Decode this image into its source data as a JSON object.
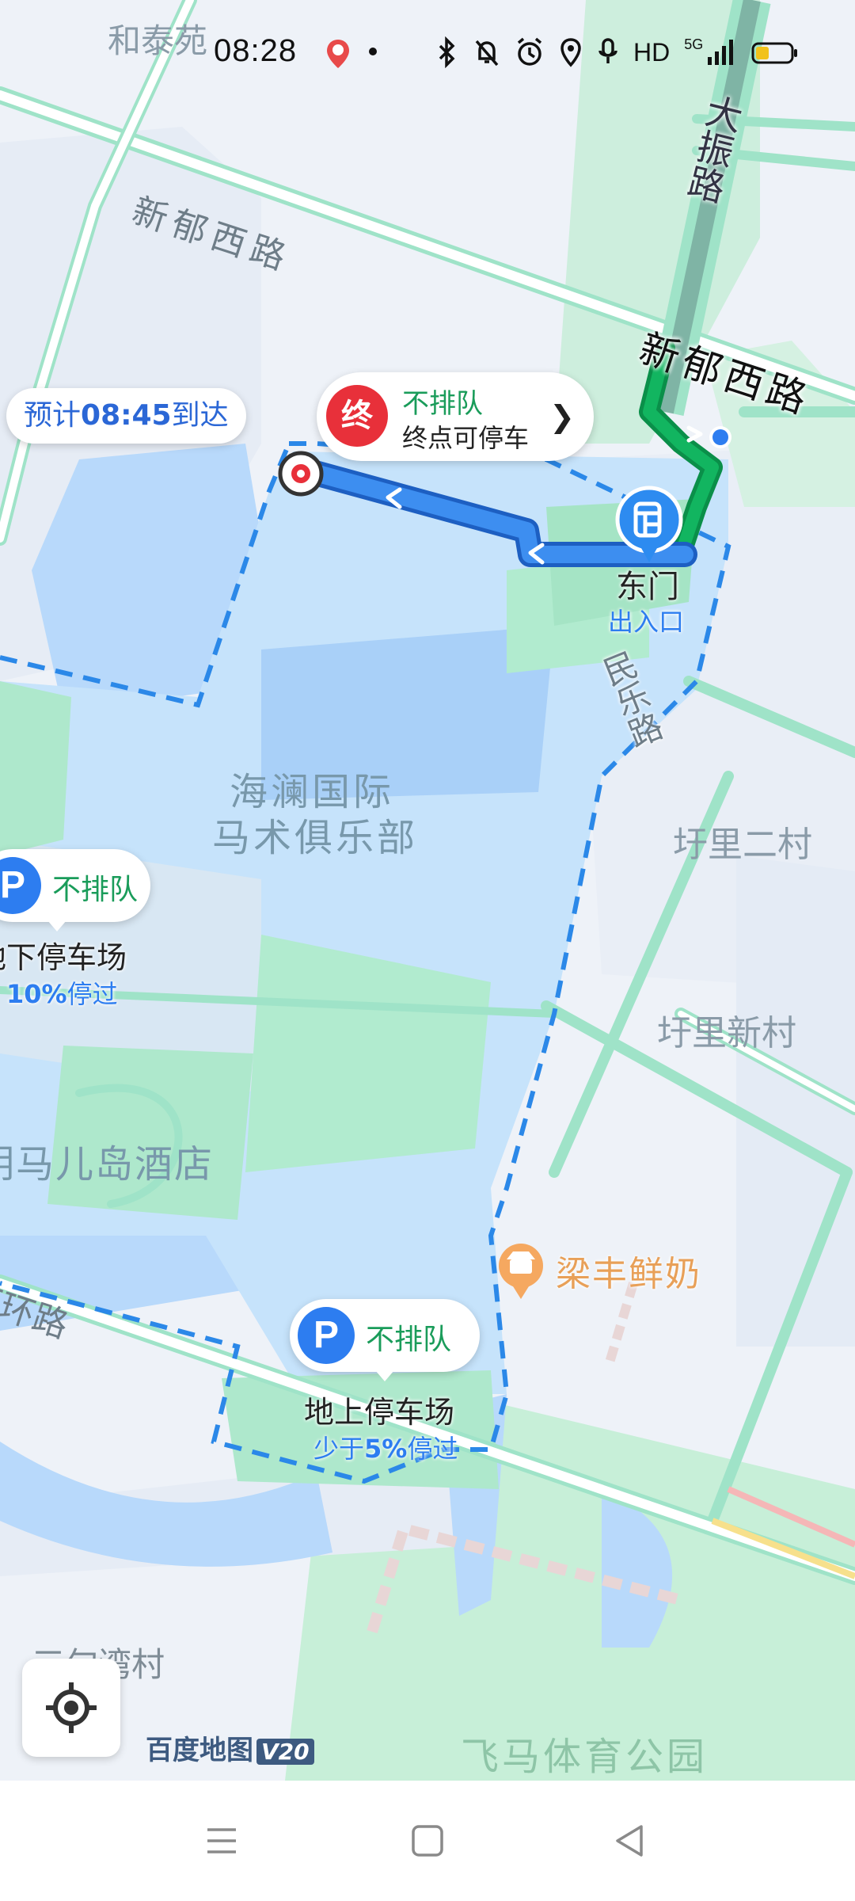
{
  "status_bar": {
    "time": "08:28",
    "hd": "HD",
    "network": "5G"
  },
  "map": {
    "labels": {
      "hetaiyuan": "和泰苑",
      "xinyu_west_road_top": "新郁西路",
      "xinyu_west_road_main": "新郁西路",
      "dazhen_road": "大振路",
      "minle_road": "民乐路",
      "club": "海澜国际\n马术俱乐部",
      "club_line1": "海澜国际",
      "club_line2": "马术俱乐部",
      "yuli_ercun": "圩里二村",
      "yuli_xincun": "圩里新村",
      "hotel": "明马儿岛酒店",
      "ring_road": "西环路",
      "liangfeng_milk": "梁丰鲜奶",
      "feima_park": "飞马体育公园",
      "sanqi_village": "三甸湾村"
    },
    "east_gate": {
      "name": "东门",
      "sub": "出入口"
    },
    "eta": {
      "prefix": "预计",
      "time": "08:45",
      "suffix": "到达"
    },
    "destination_card": {
      "badge": "终",
      "status": "不排队",
      "note": "终点可停车"
    },
    "parking": [
      {
        "icon": "P",
        "status": "不排队",
        "name": "地下停车场",
        "stat_value": "10%",
        "stat_suffix": "停过"
      },
      {
        "icon": "P",
        "status": "不排队",
        "name": "地上停车场",
        "stat_prefix": "少于",
        "stat_value": "5%",
        "stat_suffix": "停过"
      }
    ],
    "brand": {
      "name": "百度地图",
      "version": "V20"
    }
  },
  "colors": {
    "route_blue": "#3d8ef0",
    "route_green": "#12b560",
    "boundary": "#2b88e8",
    "road_green": "#9fe3c8",
    "water": "#b3d6fb",
    "park_green": "#c7efd8",
    "destination_red": "#e8303a"
  },
  "icons": [
    "bluetooth-icon",
    "mute-bell-icon",
    "alarm-icon",
    "location-icon",
    "mic-icon",
    "signal-icon",
    "battery-icon",
    "locate-icon",
    "menu-icon",
    "home-icon",
    "back-icon"
  ]
}
